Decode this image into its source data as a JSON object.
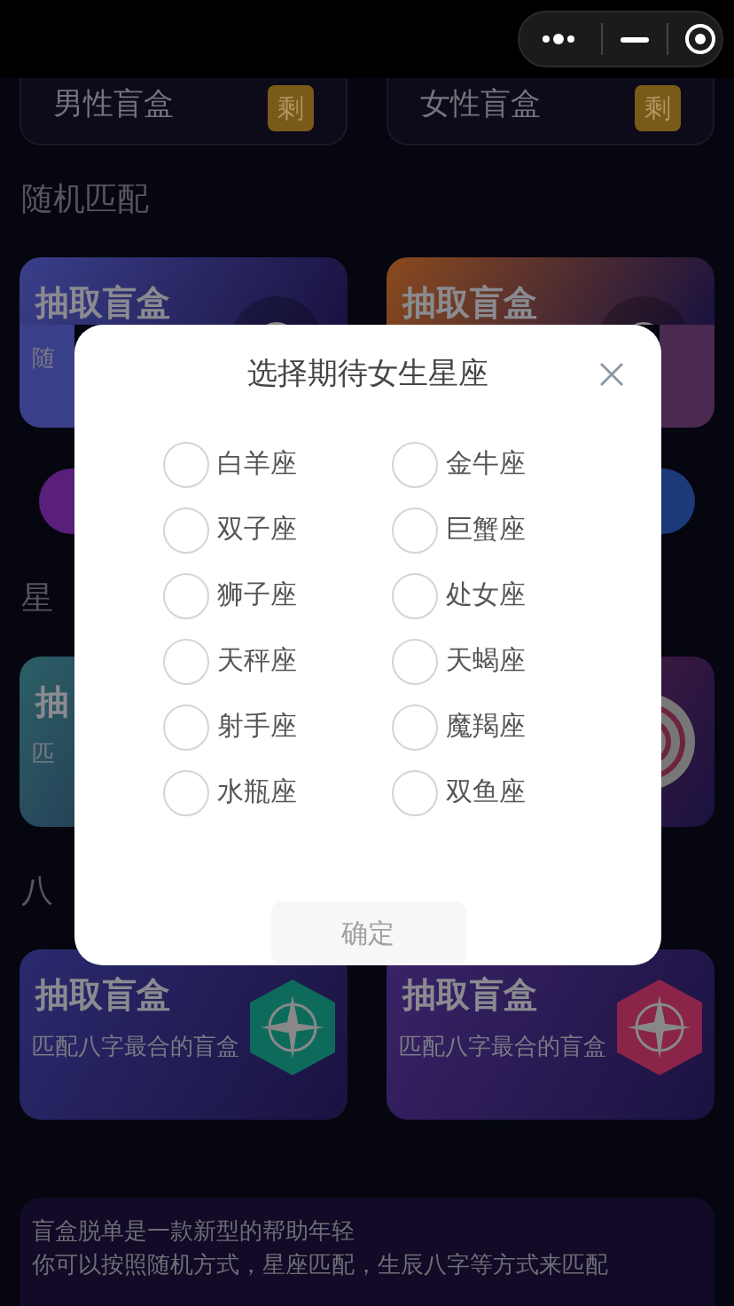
{
  "top_cards": [
    {
      "label": "男性盲盒",
      "badge": "剩"
    },
    {
      "label": "女性盲盒",
      "badge": "剩"
    }
  ],
  "sections": [
    {
      "title": "随机匹配",
      "cards": [
        {
          "title": "抽取盲盒",
          "subtitle": "随",
          "color": "#3a3f8a",
          "kind": "ring"
        },
        {
          "title": "抽取盲盒",
          "color": "#8a4a1e",
          "kind": "ring"
        }
      ],
      "pills": [
        {
          "color": "#5a1f78"
        },
        {
          "color": "#1c3a7a"
        }
      ]
    },
    {
      "title": "星",
      "cards": [
        {
          "title": "抽",
          "subtitle": "匹",
          "color": "#2c5f66",
          "kind": "plain"
        },
        {
          "color": "#6e2440",
          "kind": "spiral"
        }
      ]
    },
    {
      "title": "八",
      "cards": [
        {
          "title": "抽取盲盒",
          "subtitle": "匹配八字最合的盲盒",
          "color": "#2a2a6e",
          "kind": "hex"
        },
        {
          "title": "抽取盲盒",
          "subtitle": "匹配八字最合的盲盒",
          "color": "#3a2368",
          "kind": "hex"
        }
      ]
    }
  ],
  "description": [
    "盲盒脱单是一款新型的帮助年轻",
    "你可以按照随机方式，星座匹配，生辰八字等方式来匹配"
  ],
  "modal": {
    "title": "选择期待女生星座",
    "options": [
      {
        "label": "白羊座",
        "selected": false
      },
      {
        "label": "金牛座",
        "selected": false
      },
      {
        "label": "双子座",
        "selected": false
      },
      {
        "label": "巨蟹座",
        "selected": false
      },
      {
        "label": "狮子座",
        "selected": false
      },
      {
        "label": "处女座",
        "selected": false
      },
      {
        "label": "天秤座",
        "selected": false
      },
      {
        "label": "天蝎座",
        "selected": false
      },
      {
        "label": "射手座",
        "selected": false
      },
      {
        "label": "魔羯座",
        "selected": false
      },
      {
        "label": "水瓶座",
        "selected": false
      },
      {
        "label": "双鱼座",
        "selected": false
      }
    ],
    "confirm": {
      "label": "确定",
      "disabled": true
    }
  }
}
